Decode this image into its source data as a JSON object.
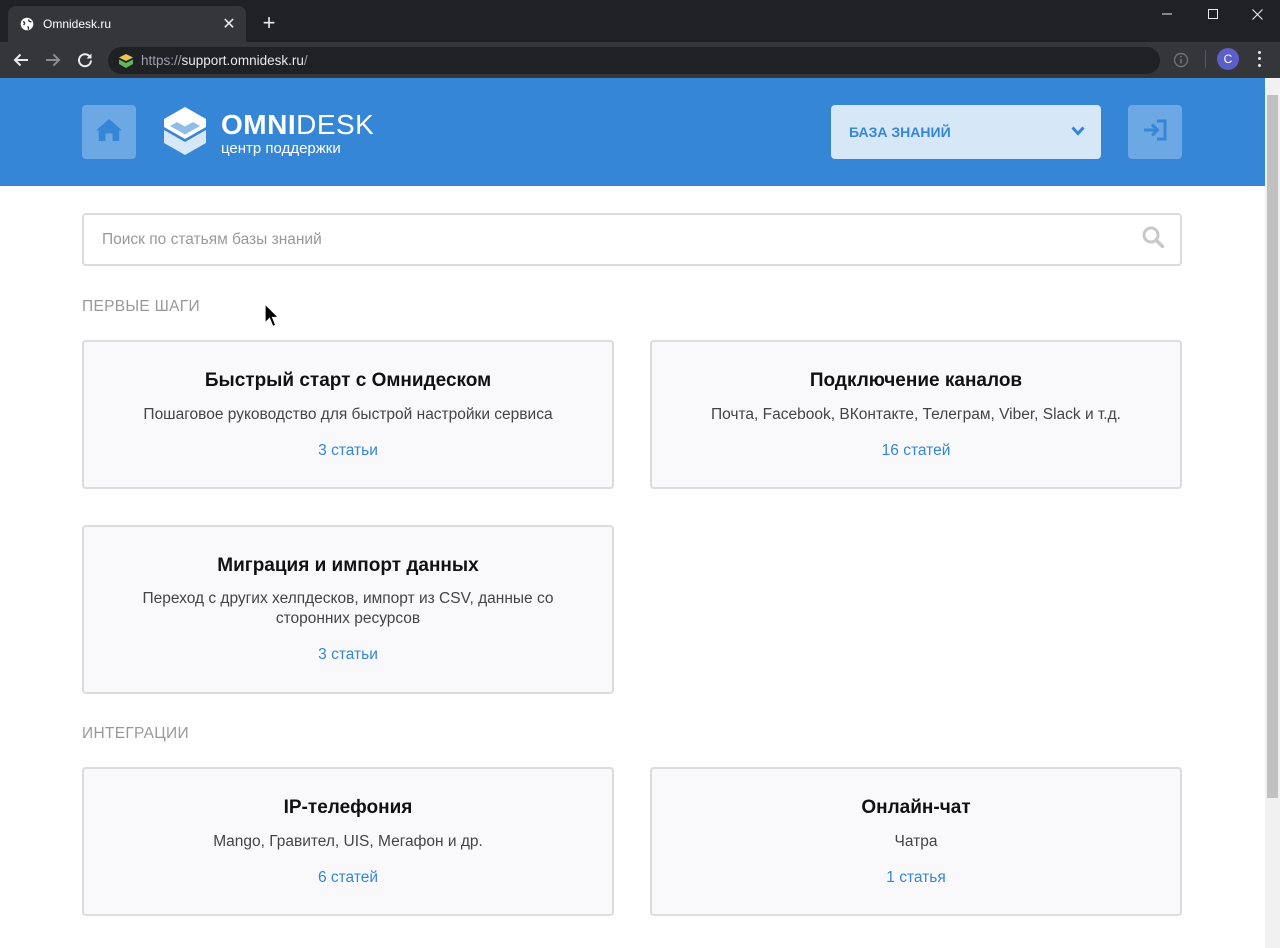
{
  "browser": {
    "tab_title": "Omnidesk.ru",
    "new_tab": "+",
    "url_scheme": "https://",
    "url_host": "support.omnidesk.ru",
    "url_path": "/",
    "profile_initial": "C"
  },
  "header": {
    "logo_brand_bold": "OMNI",
    "logo_brand_thin": "DESK",
    "logo_subtitle": "центр поддержки",
    "kb_select_label": "БАЗА ЗНАНИЙ"
  },
  "search": {
    "placeholder": "Поиск по статьям базы знаний"
  },
  "sections": [
    {
      "title": "ПЕРВЫЕ ШАГИ",
      "cards": [
        {
          "title": "Быстрый старт с Омнидеском",
          "desc": "Пошаговое руководство для быстрой настройки сервиса",
          "count": "3 статьи"
        },
        {
          "title": "Подключение каналов",
          "desc": "Почта, Facebook, ВКонтакте, Телеграм, Viber, Slack и т.д.",
          "count": "16 статей"
        },
        {
          "title": "Миграция и импорт данных",
          "desc": "Переход с других хелпдесков, импорт из CSV, данные со сторонних ресурсов",
          "count": "3 статьи"
        }
      ]
    },
    {
      "title": "ИНТЕГРАЦИИ",
      "cards": [
        {
          "title": "IP-телефония",
          "desc": "Mango, Гравител, UIS, Мегафон и др.",
          "count": "6 статей"
        },
        {
          "title": "Онлайн-чат",
          "desc": "Чатра",
          "count": "1 статья"
        }
      ]
    }
  ],
  "colors": {
    "brand_blue": "#3586d6",
    "header_button": "#6ca8e4",
    "select_bg": "#d6e7f8",
    "card_bg": "#f9f9fb",
    "card_border": "#dcdcdc",
    "section_title": "#999999"
  },
  "icons": {
    "home": "home-icon",
    "login": "login-icon",
    "search": "search-icon",
    "dropdown": "chevron-down-icon",
    "logo": "omnidesk-logo-icon"
  }
}
